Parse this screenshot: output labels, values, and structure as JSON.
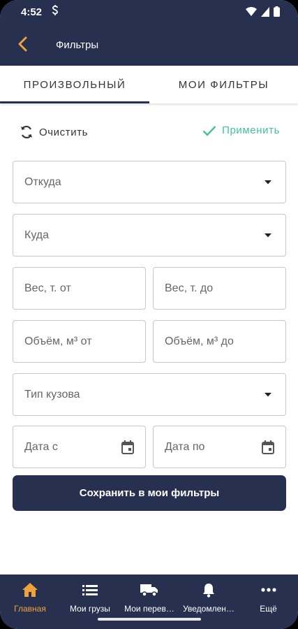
{
  "status_bar": {
    "time": "4:52"
  },
  "header": {
    "title": "Фильтры"
  },
  "tabs": [
    {
      "label": "ПРОИЗВОЛЬНЫЙ",
      "active": true
    },
    {
      "label": "МОИ ФИЛЬТРЫ",
      "active": false
    }
  ],
  "actions": {
    "clear_label": "Очистить",
    "apply_label": "Применить"
  },
  "form": {
    "from": {
      "placeholder": "Откуда"
    },
    "to": {
      "placeholder": "Куда"
    },
    "weight_from": {
      "placeholder": "Вес, т. от"
    },
    "weight_to": {
      "placeholder": "Вес, т. до"
    },
    "volume_from": {
      "placeholder": "Объём, м³ от"
    },
    "volume_to": {
      "placeholder": "Объём, м³ до"
    },
    "body_type": {
      "placeholder": "Тип кузова"
    },
    "date_from": {
      "placeholder": "Дата с"
    },
    "date_to": {
      "placeholder": "Дата по"
    }
  },
  "save_button": {
    "label": "Сохранить в мои фильтры"
  },
  "bottom_nav": [
    {
      "label": "Главная",
      "icon": "home-icon",
      "active": true
    },
    {
      "label": "Мои грузы",
      "icon": "list-icon",
      "active": false
    },
    {
      "label": "Мои перев…",
      "icon": "truck-icon",
      "active": false
    },
    {
      "label": "Уведомлен…",
      "icon": "bell-icon",
      "active": false
    },
    {
      "label": "Ещё",
      "icon": "more-icon",
      "active": false
    }
  ],
  "colors": {
    "primary": "#283050",
    "accent_orange": "#f0a23a",
    "apply_green": "#3fc49a"
  }
}
